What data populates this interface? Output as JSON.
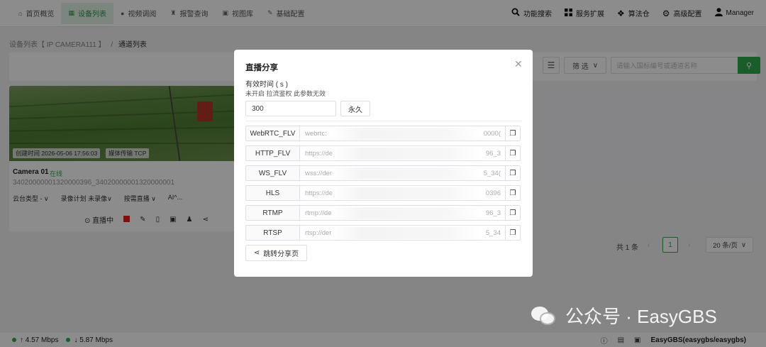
{
  "nav": {
    "left": [
      {
        "icon": "home-icon",
        "glyph": "⌂",
        "label": "首页概览"
      },
      {
        "icon": "list-icon",
        "glyph": "▦",
        "label": "设备列表",
        "active": true
      },
      {
        "icon": "play-icon",
        "glyph": "●",
        "label": "视频调阅"
      },
      {
        "icon": "alarm-icon",
        "glyph": "♜",
        "label": "报警查询"
      },
      {
        "icon": "image-icon",
        "glyph": "▣",
        "label": "视图库"
      },
      {
        "icon": "edit-icon",
        "glyph": "✎",
        "label": "基础配置"
      }
    ],
    "right": [
      {
        "icon": "search-icon",
        "glyph": "🔍",
        "label": "功能搜索"
      },
      {
        "icon": "grid-icon",
        "glyph": "▦",
        "label": "服务扩展"
      },
      {
        "icon": "dropbox-icon",
        "glyph": "❖",
        "label": "算法仓"
      },
      {
        "icon": "gear-icon",
        "glyph": "⚙",
        "label": "高级配置"
      },
      {
        "icon": "user-icon",
        "glyph": "👤",
        "label": "Manager"
      }
    ]
  },
  "breadcrumb": {
    "parent": "设备列表【 IP CAMERA111 】",
    "sep": "/",
    "current": "通道列表"
  },
  "toolbar": {
    "filter_label": "筛 选",
    "search_placeholder": "请输入国标编号或通道名称"
  },
  "card": {
    "created": "创建时间 2026-05-06 17:56:03",
    "transport": "媒体传输 TCP",
    "name": "Camera 01",
    "status": "在线",
    "id": "34020000001320000396_34020000001320000001",
    "options": [
      "云台类型 - ∨",
      "录像计划 未录像∨",
      "按需直播 ∨",
      "AI^..."
    ],
    "live_label": "直播中"
  },
  "pagination": {
    "total": "共 1 条",
    "page": "1",
    "size": "20 条/页"
  },
  "dialog": {
    "title": "直播分享",
    "valid_label": "有效时间 ( s )",
    "hint": "未开启 拉流鉴权 此参数无效",
    "duration_value": "300",
    "forever_label": "永久",
    "urls": [
      {
        "label": "WebRTC_FLV",
        "prefix": "webrtc:",
        "tail": "0000("
      },
      {
        "label": "HTTP_FLV",
        "prefix": "https://de",
        "tail": "96_3"
      },
      {
        "label": "WS_FLV",
        "prefix": "wss://den",
        "tail": "5_34("
      },
      {
        "label": "HLS",
        "prefix": "https://de",
        "tail": "0396"
      },
      {
        "label": "RTMP",
        "prefix": "rtmp://de",
        "tail": "96_3"
      },
      {
        "label": "RTSP",
        "prefix": "rtsp://der",
        "tail": "5_34"
      }
    ],
    "share_label": "跳转分享页"
  },
  "watermark": "公众号 · EasyGBS",
  "statusbar": {
    "up": "↑ 4.57 Mbps",
    "down": "↓ 5.87 Mbps",
    "user": "EasyGBS(easygbs/easygbs)"
  },
  "colors": {
    "accent": "#2eaa4f",
    "record": "#e02020"
  }
}
